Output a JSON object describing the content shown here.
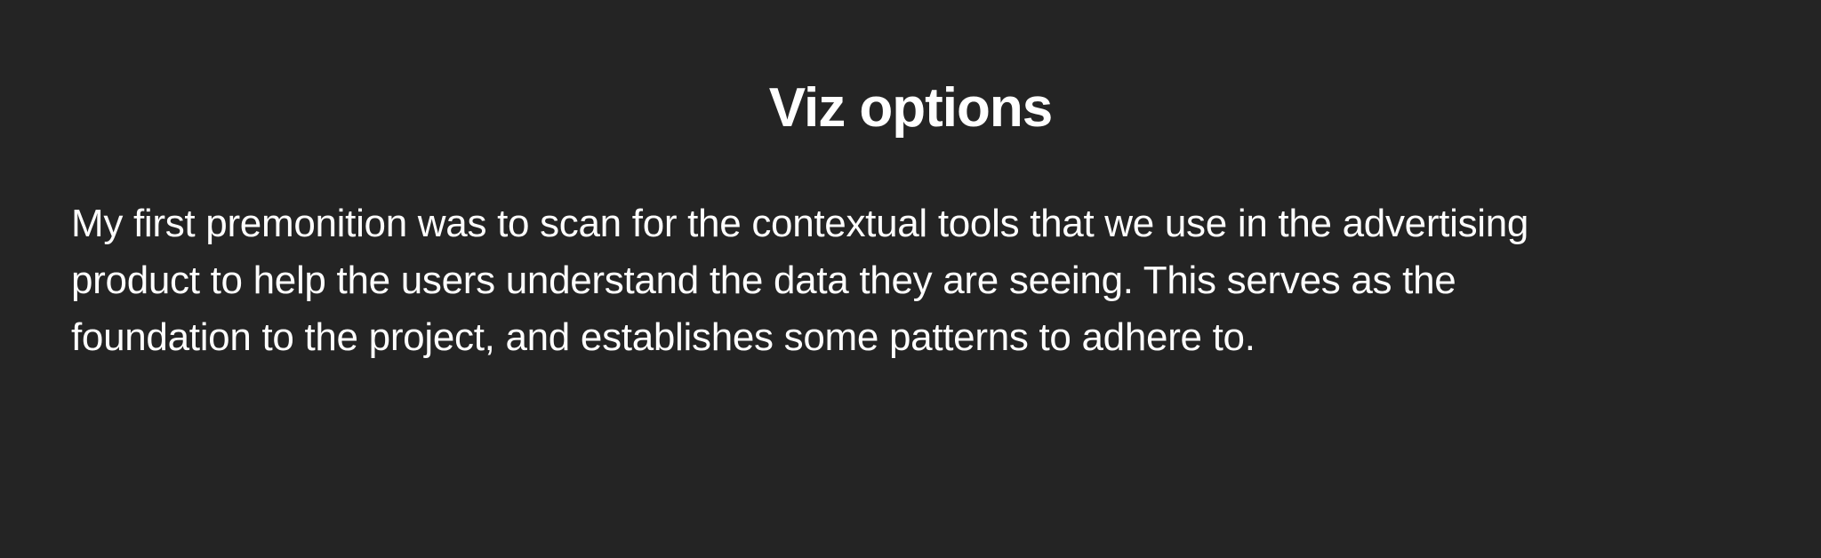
{
  "heading": {
    "title": "Viz options"
  },
  "paragraph": {
    "lines": [
      "My first premonition was to scan for the contextual tools that we use in the advertising",
      "product to help the users understand the data they are seeing. This serves as the",
      "foundation to the project, and establishes some patterns to adhere to."
    ]
  },
  "colors": {
    "background": "#242424",
    "text": "#ffffff"
  }
}
